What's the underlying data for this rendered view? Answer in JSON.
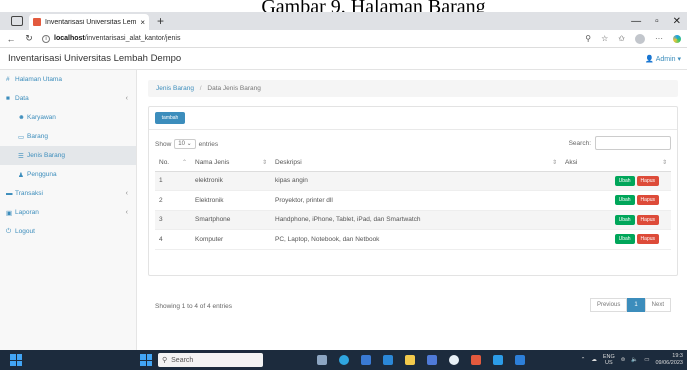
{
  "caption": "Gambar 9. Halaman Barang",
  "browser": {
    "tab_title": "Inventarisasi Universitas Lembah",
    "tab_close": "×",
    "new_tab": "+",
    "url_host": "localhost",
    "url_path": "/inventarisasi_alat_kantor/jenis"
  },
  "app": {
    "brand": "Inventarisasi Universitas Lembah Dempo",
    "user": "Admin"
  },
  "sidebar": {
    "items": [
      {
        "label": "Halaman Utama"
      },
      {
        "label": "Data"
      },
      {
        "label": "Karyawan"
      },
      {
        "label": "Barang"
      },
      {
        "label": "Jenis Barang"
      },
      {
        "label": "Pengguna"
      },
      {
        "label": "Transaksi"
      },
      {
        "label": "Laporan"
      },
      {
        "label": "Logout"
      }
    ]
  },
  "breadcrumb": {
    "parent": "Jenis Barang",
    "current": "Data Jenis Barang"
  },
  "toolbar": {
    "add_label": "tambah"
  },
  "table_controls": {
    "show_label": "Show",
    "entries_value": "10",
    "entries_label": "entries",
    "search_label": "Search:"
  },
  "table": {
    "headers": [
      "No.",
      "Nama Jenis",
      "Deskripsi",
      "Aksi"
    ],
    "rows": [
      {
        "no": "1",
        "nama": "elektronik",
        "deskripsi": "kipas angin"
      },
      {
        "no": "2",
        "nama": "Elektronik",
        "deskripsi": "Proyektor, printer dll"
      },
      {
        "no": "3",
        "nama": "Smartphone",
        "deskripsi": "Handphone, iPhone, Tablet, iPad, dan Smartwatch"
      },
      {
        "no": "4",
        "nama": "Komputer",
        "deskripsi": "PC, Laptop, Notebook, dan Netbook"
      }
    ],
    "edit_label": "Ubah",
    "delete_label": "Hapus"
  },
  "footer": {
    "info": "Showing 1 to 4 of 4 entries",
    "previous": "Previous",
    "page": "1",
    "next": "Next"
  },
  "taskbar": {
    "search_placeholder": "Search",
    "lang_top": "ENG",
    "lang_bottom": "US",
    "time": "19:3",
    "date": "09/06/2023"
  },
  "colors": {
    "primary": "#3c8dbc",
    "success": "#00a65a",
    "danger": "#dd4b39",
    "taskbar": "#1c2b3d"
  }
}
